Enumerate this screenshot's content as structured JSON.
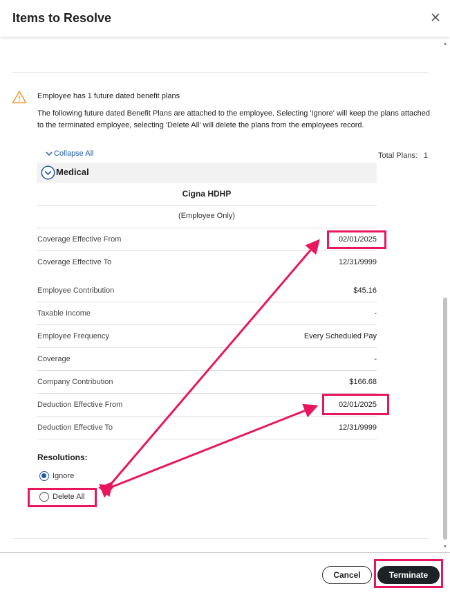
{
  "modal": {
    "title": "Items to Resolve",
    "close_icon": "close-icon"
  },
  "warning": {
    "icon": "warning-icon",
    "title": "Employee has 1 future dated benefit plans",
    "description": "The following future dated Benefit Plans are attached to the employee. Selecting 'Ignore' will keep the plans attached to the terminated employee, selecting 'Delete All' will delete the plans from the employees record."
  },
  "plans": {
    "collapse_all_label": "Collapse All",
    "total_plans_label": "Total Plans:",
    "total_plans_value": "1",
    "section_label": "Medical",
    "plan_name": "Cigna HDHP",
    "plan_type": "(Employee Only)",
    "rows": [
      {
        "label": "Coverage Effective From",
        "value": "02/01/2025"
      },
      {
        "label": "Coverage Effective To",
        "value": "12/31/9999"
      },
      {
        "label": "Employee Contribution",
        "value": "$45.16"
      },
      {
        "label": "Taxable Income",
        "value": "-"
      },
      {
        "label": "Employee Frequency",
        "value": "Every Scheduled Pay"
      },
      {
        "label": "Coverage",
        "value": "-"
      },
      {
        "label": "Company Contribution",
        "value": "$166.68"
      },
      {
        "label": "Deduction Effective From",
        "value": "02/01/2025"
      },
      {
        "label": "Deduction Effective To",
        "value": "12/31/9999"
      }
    ]
  },
  "resolutions": {
    "label": "Resolutions:",
    "options": [
      {
        "label": "Ignore",
        "selected": true
      },
      {
        "label": "Delete All",
        "selected": false
      }
    ]
  },
  "footer": {
    "cancel_label": "Cancel",
    "terminate_label": "Terminate"
  },
  "colors": {
    "accent": "#1b5aa5",
    "annotation": "#e8175d",
    "warning": "#f0a030",
    "primary_button": "#1c2226"
  }
}
